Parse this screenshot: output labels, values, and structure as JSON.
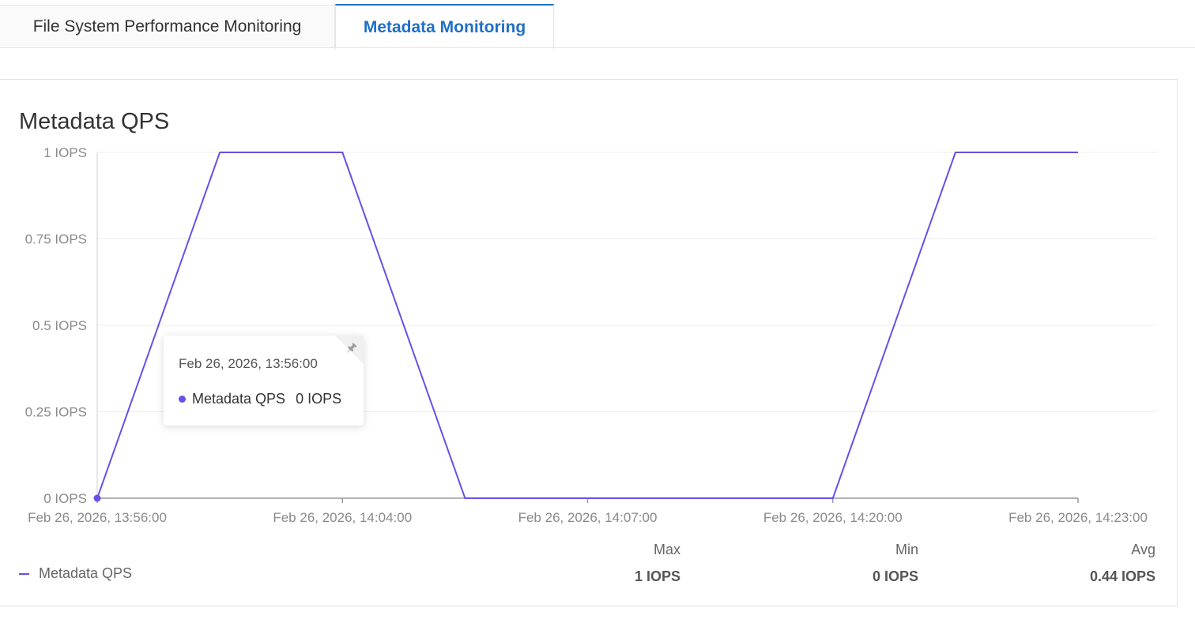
{
  "tabs": [
    {
      "label": "File System Performance Monitoring",
      "active": false
    },
    {
      "label": "Metadata Monitoring",
      "active": true
    }
  ],
  "colors": {
    "accent": "#1f6fc5",
    "series": "#6a4fe8",
    "grid": "#eeeeee",
    "axis": "#9a9a9a"
  },
  "chart_data": {
    "type": "line",
    "title": "Metadata QPS",
    "xlabel": "",
    "ylabel": "",
    "unit": "IOPS",
    "ylim": [
      0,
      1
    ],
    "y_ticks": [
      "1 IOPS",
      "0.75 IOPS",
      "0.5 IOPS",
      "0.25 IOPS",
      "0 IOPS"
    ],
    "y_tick_values": [
      1,
      0.75,
      0.5,
      0.25,
      0
    ],
    "x_ticks": [
      "Feb 26, 2026, 13:56:00",
      "Feb 26, 2026, 14:04:00",
      "Feb 26, 2026, 14:07:00",
      "Feb 26, 2026, 14:20:00",
      "Feb 26, 2026, 14:23:00"
    ],
    "x_tick_index": [
      0,
      2,
      4,
      6,
      8
    ],
    "grid": true,
    "legend": "bottom-left",
    "series": [
      {
        "name": "Metadata QPS",
        "values": [
          0,
          1,
          1,
          0,
          0,
          0,
          0,
          1,
          1
        ]
      }
    ]
  },
  "tooltip": {
    "time": "Feb 26, 2026, 13:56:00",
    "series_name": "Metadata QPS",
    "value": "0 IOPS",
    "pin_icon": "pin-icon"
  },
  "legend": {
    "label": "Metadata QPS"
  },
  "stats": {
    "max_label": "Max",
    "max_value": "1 IOPS",
    "min_label": "Min",
    "min_value": "0 IOPS",
    "avg_label": "Avg",
    "avg_value": "0.44 IOPS"
  }
}
